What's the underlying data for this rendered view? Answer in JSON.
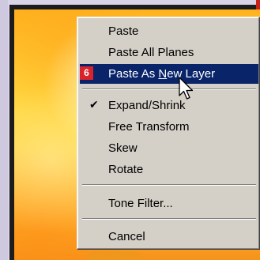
{
  "step_badge": "6",
  "menu": {
    "items": [
      {
        "label": "Paste"
      },
      {
        "label": "Paste All Planes"
      },
      {
        "label_before": "Paste As ",
        "label_underlined": "N",
        "label_after": "ew Layer",
        "highlighted": true
      },
      {
        "label": "Expand/Shrink",
        "checked": true,
        "check_glyph": "✔"
      },
      {
        "label": "Free Transform"
      },
      {
        "label": "Skew"
      },
      {
        "label": "Rotate"
      },
      {
        "label": "Tone Filter..."
      },
      {
        "label": "Cancel"
      }
    ]
  },
  "colors": {
    "highlight": "#0a246a",
    "menu_bg": "#d4d0c8",
    "badge": "#d8232a"
  },
  "icons": {
    "cursor": "arrow-pointer-icon",
    "check": "checkmark-icon"
  }
}
